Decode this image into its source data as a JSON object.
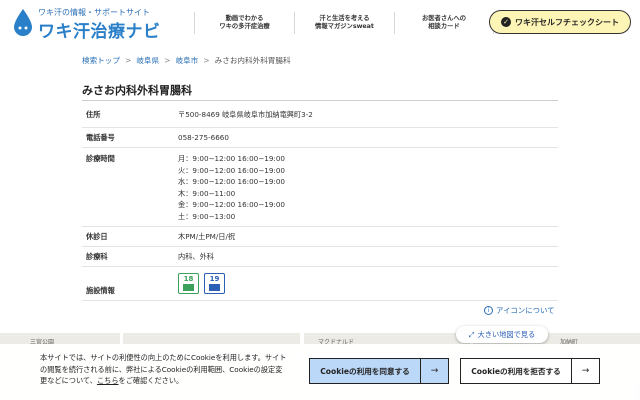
{
  "header": {
    "logo_sub": "ワキ汗の情報・サポートサイト",
    "logo_title": "ワキ汗治療ナビ",
    "nav": [
      {
        "line1": "動画でわかる",
        "line2": "ワキの多汗症治療"
      },
      {
        "line1": "汗と生活を考える",
        "line2": "情報マガジンsweat"
      },
      {
        "line1": "お医者さんへの",
        "line2": "相談カード"
      }
    ],
    "check_label": "ワキ汗セルフチェックシート",
    "check_icon": "check-icon"
  },
  "breadcrumb": {
    "items": [
      "検索トップ",
      "岐阜県",
      "岐阜市"
    ],
    "separator": ">",
    "current": "みさお内科外科胃腸科"
  },
  "clinic": {
    "name": "みさお内科外科胃腸科",
    "address_label": "住所",
    "address": "〒500-8469 岐阜県岐阜市加納竜興町3-2",
    "phone_label": "電話番号",
    "phone": "058-275-6660",
    "hours_label": "診療時間",
    "hours": [
      "月：9:00−12:00 16:00−19:00",
      "火：9:00−12:00 16:00−19:00",
      "水：9:00−12:00 16:00−19:00",
      "木：9:00−11:00",
      "金：9:00−12:00 16:00−19:00",
      "土：9:00−13:00"
    ],
    "closed_label": "休診日",
    "closed": "木PM/土PM/日/祝",
    "departments_label": "診療科",
    "departments": "内科、外科",
    "facility_label": "施設情報",
    "facilities": [
      {
        "number": "18",
        "color": "#3aa05a"
      },
      {
        "number": "19",
        "color": "#2a5fb5"
      }
    ]
  },
  "icon_about": "アイコンについて",
  "map": {
    "labels": [
      "三宮公園",
      "マクドナルド",
      "加納町"
    ],
    "big_map_label": "大きい地図で見る"
  },
  "cookie": {
    "text_before_link": "本サイトでは、サイトの利便性の向上のためにCookieを利用します。サイトの閲覧を続行される前に、弊社によるCookieの利用範囲、Cookieの設定変更などについて、",
    "link": "こちら",
    "text_after_link": "をご確認ください。",
    "agree": "Cookieの利用を同意する",
    "reject": "Cookieの利用を拒否する",
    "arrow": "→"
  }
}
